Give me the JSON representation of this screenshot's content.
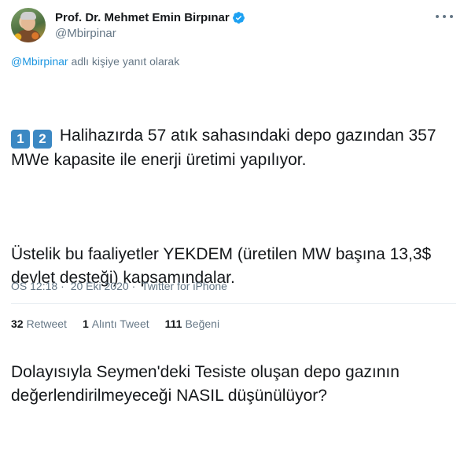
{
  "author": {
    "display_name": "Prof. Dr. Mehmet Emin Birpınar",
    "handle": "@Mbirpinar",
    "verified": true,
    "verified_color": "#1da1f2"
  },
  "reply_to": {
    "handle": "@Mbirpinar",
    "suffix": "adlı kişiye yanıt olarak"
  },
  "tweet": {
    "keycap_1": "1",
    "keycap_2": "2",
    "paragraphs": [
      "Halihazırda 57 atık sahasındaki depo gazından 357 MWe kapasite ile enerji üretimi yapılıyor.",
      "Üstelik bu faaliyetler YEKDEM (üretilen MW başına 13,3$ devlet desteği) kapsamındalar.",
      "Dolayısıyla Seymen'deki Tesiste oluşan depo gazının değerlendirilmeyeceği NASIL düşünülüyor?"
    ]
  },
  "meta": {
    "time": "ÖS 12:18",
    "separator": "·",
    "date": "20 Eki 2020",
    "source": "Twitter for iPhone"
  },
  "stats": {
    "retweets_count": "32",
    "retweets_label": "Retweet",
    "quotes_count": "1",
    "quotes_label": "Alıntı Tweet",
    "likes_count": "111",
    "likes_label": "Beğeni"
  },
  "icons": {
    "verified": "verified-badge-icon",
    "more": "more-options-icon"
  },
  "colors": {
    "link": "#1b95e0",
    "secondary_text": "#657786",
    "primary_text": "#14171a",
    "keycap": "#3b88c3"
  }
}
